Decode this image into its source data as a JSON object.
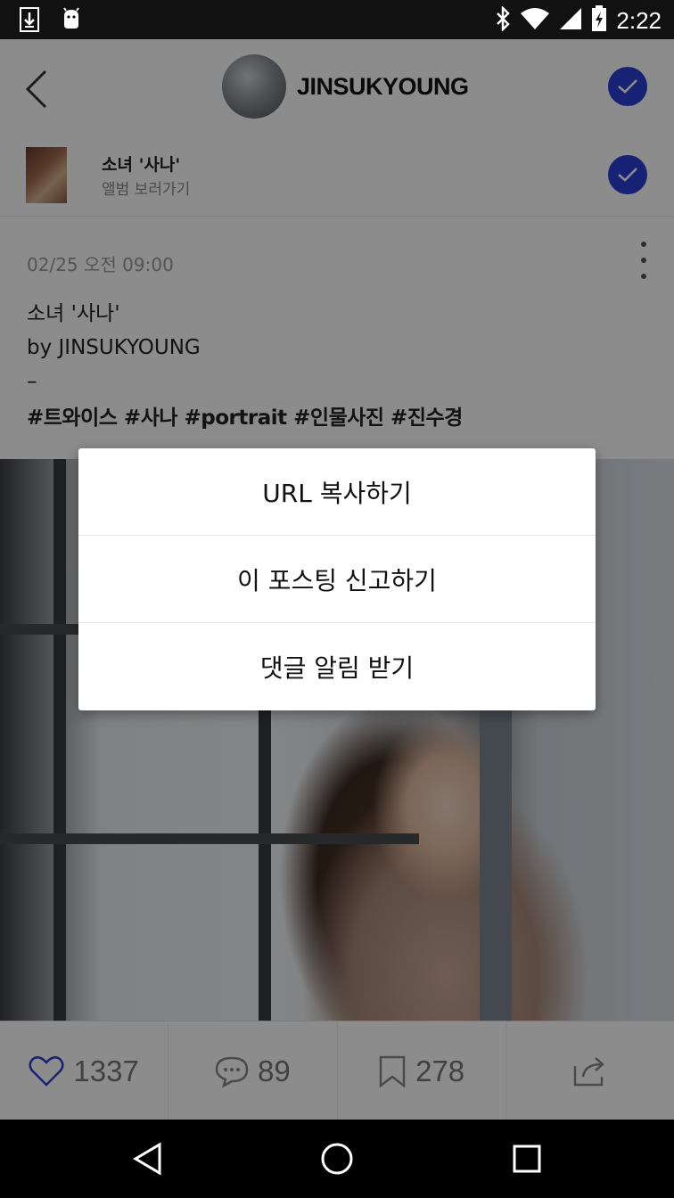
{
  "status_bar": {
    "time": "2:22",
    "icons": [
      "download-icon",
      "android-icon",
      "bluetooth-icon",
      "wifi-icon",
      "signal-icon",
      "battery-icon"
    ]
  },
  "header": {
    "username": "JINSUKYOUNG",
    "accent_color": "#2b3fd6"
  },
  "album": {
    "title": "소녀 '사나'",
    "subtitle": "앨범 보러가기"
  },
  "post": {
    "date": "02/25 오전 09:00",
    "lines": [
      "소녀 '사나'",
      "by JINSUKYOUNG",
      "–"
    ],
    "tags": "#트와이스 #사나 #portrait #인물사진 #진수경"
  },
  "actions": {
    "likes": "1337",
    "comments": "89",
    "bookmarks": "278"
  },
  "dialog": {
    "items": [
      "URL 복사하기",
      "이 포스팅 신고하기",
      "댓글 알림 받기"
    ]
  }
}
